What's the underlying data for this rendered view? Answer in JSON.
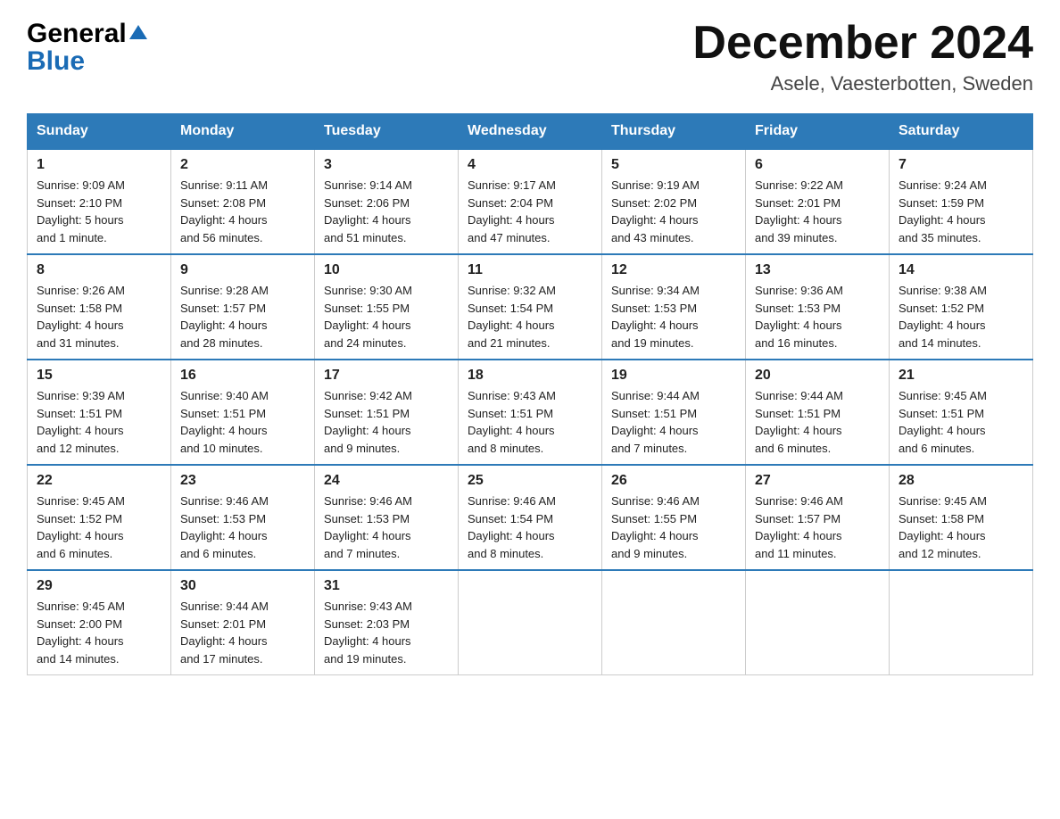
{
  "header": {
    "logo_general": "General",
    "logo_blue": "Blue",
    "title": "December 2024",
    "location": "Asele, Vaesterbotten, Sweden"
  },
  "days_of_week": [
    "Sunday",
    "Monday",
    "Tuesday",
    "Wednesday",
    "Thursday",
    "Friday",
    "Saturday"
  ],
  "weeks": [
    [
      {
        "day": "1",
        "sunrise": "9:09 AM",
        "sunset": "2:10 PM",
        "daylight": "5 hours and 1 minute."
      },
      {
        "day": "2",
        "sunrise": "9:11 AM",
        "sunset": "2:08 PM",
        "daylight": "4 hours and 56 minutes."
      },
      {
        "day": "3",
        "sunrise": "9:14 AM",
        "sunset": "2:06 PM",
        "daylight": "4 hours and 51 minutes."
      },
      {
        "day": "4",
        "sunrise": "9:17 AM",
        "sunset": "2:04 PM",
        "daylight": "4 hours and 47 minutes."
      },
      {
        "day": "5",
        "sunrise": "9:19 AM",
        "sunset": "2:02 PM",
        "daylight": "4 hours and 43 minutes."
      },
      {
        "day": "6",
        "sunrise": "9:22 AM",
        "sunset": "2:01 PM",
        "daylight": "4 hours and 39 minutes."
      },
      {
        "day": "7",
        "sunrise": "9:24 AM",
        "sunset": "1:59 PM",
        "daylight": "4 hours and 35 minutes."
      }
    ],
    [
      {
        "day": "8",
        "sunrise": "9:26 AM",
        "sunset": "1:58 PM",
        "daylight": "4 hours and 31 minutes."
      },
      {
        "day": "9",
        "sunrise": "9:28 AM",
        "sunset": "1:57 PM",
        "daylight": "4 hours and 28 minutes."
      },
      {
        "day": "10",
        "sunrise": "9:30 AM",
        "sunset": "1:55 PM",
        "daylight": "4 hours and 24 minutes."
      },
      {
        "day": "11",
        "sunrise": "9:32 AM",
        "sunset": "1:54 PM",
        "daylight": "4 hours and 21 minutes."
      },
      {
        "day": "12",
        "sunrise": "9:34 AM",
        "sunset": "1:53 PM",
        "daylight": "4 hours and 19 minutes."
      },
      {
        "day": "13",
        "sunrise": "9:36 AM",
        "sunset": "1:53 PM",
        "daylight": "4 hours and 16 minutes."
      },
      {
        "day": "14",
        "sunrise": "9:38 AM",
        "sunset": "1:52 PM",
        "daylight": "4 hours and 14 minutes."
      }
    ],
    [
      {
        "day": "15",
        "sunrise": "9:39 AM",
        "sunset": "1:51 PM",
        "daylight": "4 hours and 12 minutes."
      },
      {
        "day": "16",
        "sunrise": "9:40 AM",
        "sunset": "1:51 PM",
        "daylight": "4 hours and 10 minutes."
      },
      {
        "day": "17",
        "sunrise": "9:42 AM",
        "sunset": "1:51 PM",
        "daylight": "4 hours and 9 minutes."
      },
      {
        "day": "18",
        "sunrise": "9:43 AM",
        "sunset": "1:51 PM",
        "daylight": "4 hours and 8 minutes."
      },
      {
        "day": "19",
        "sunrise": "9:44 AM",
        "sunset": "1:51 PM",
        "daylight": "4 hours and 7 minutes."
      },
      {
        "day": "20",
        "sunrise": "9:44 AM",
        "sunset": "1:51 PM",
        "daylight": "4 hours and 6 minutes."
      },
      {
        "day": "21",
        "sunrise": "9:45 AM",
        "sunset": "1:51 PM",
        "daylight": "4 hours and 6 minutes."
      }
    ],
    [
      {
        "day": "22",
        "sunrise": "9:45 AM",
        "sunset": "1:52 PM",
        "daylight": "4 hours and 6 minutes."
      },
      {
        "day": "23",
        "sunrise": "9:46 AM",
        "sunset": "1:53 PM",
        "daylight": "4 hours and 6 minutes."
      },
      {
        "day": "24",
        "sunrise": "9:46 AM",
        "sunset": "1:53 PM",
        "daylight": "4 hours and 7 minutes."
      },
      {
        "day": "25",
        "sunrise": "9:46 AM",
        "sunset": "1:54 PM",
        "daylight": "4 hours and 8 minutes."
      },
      {
        "day": "26",
        "sunrise": "9:46 AM",
        "sunset": "1:55 PM",
        "daylight": "4 hours and 9 minutes."
      },
      {
        "day": "27",
        "sunrise": "9:46 AM",
        "sunset": "1:57 PM",
        "daylight": "4 hours and 11 minutes."
      },
      {
        "day": "28",
        "sunrise": "9:45 AM",
        "sunset": "1:58 PM",
        "daylight": "4 hours and 12 minutes."
      }
    ],
    [
      {
        "day": "29",
        "sunrise": "9:45 AM",
        "sunset": "2:00 PM",
        "daylight": "4 hours and 14 minutes."
      },
      {
        "day": "30",
        "sunrise": "9:44 AM",
        "sunset": "2:01 PM",
        "daylight": "4 hours and 17 minutes."
      },
      {
        "day": "31",
        "sunrise": "9:43 AM",
        "sunset": "2:03 PM",
        "daylight": "4 hours and 19 minutes."
      },
      null,
      null,
      null,
      null
    ]
  ]
}
